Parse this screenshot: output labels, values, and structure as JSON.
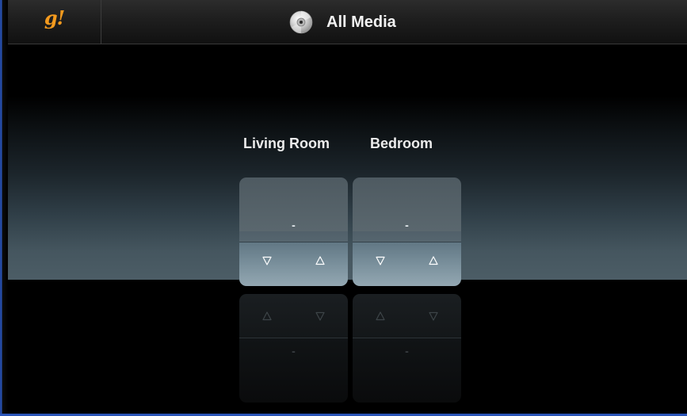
{
  "header": {
    "logo_text": "g!",
    "title": "All Media",
    "title_icon": "disc-icon"
  },
  "zones": [
    {
      "label": "Living Room",
      "value": "-",
      "down_icon": "triangle-down-icon",
      "up_icon": "triangle-up-icon"
    },
    {
      "label": "Bedroom",
      "value": "-",
      "down_icon": "triangle-down-icon",
      "up_icon": "triangle-up-icon"
    }
  ],
  "colors": {
    "logo": "#f39a1e",
    "accent_border": "#2a55b8"
  }
}
